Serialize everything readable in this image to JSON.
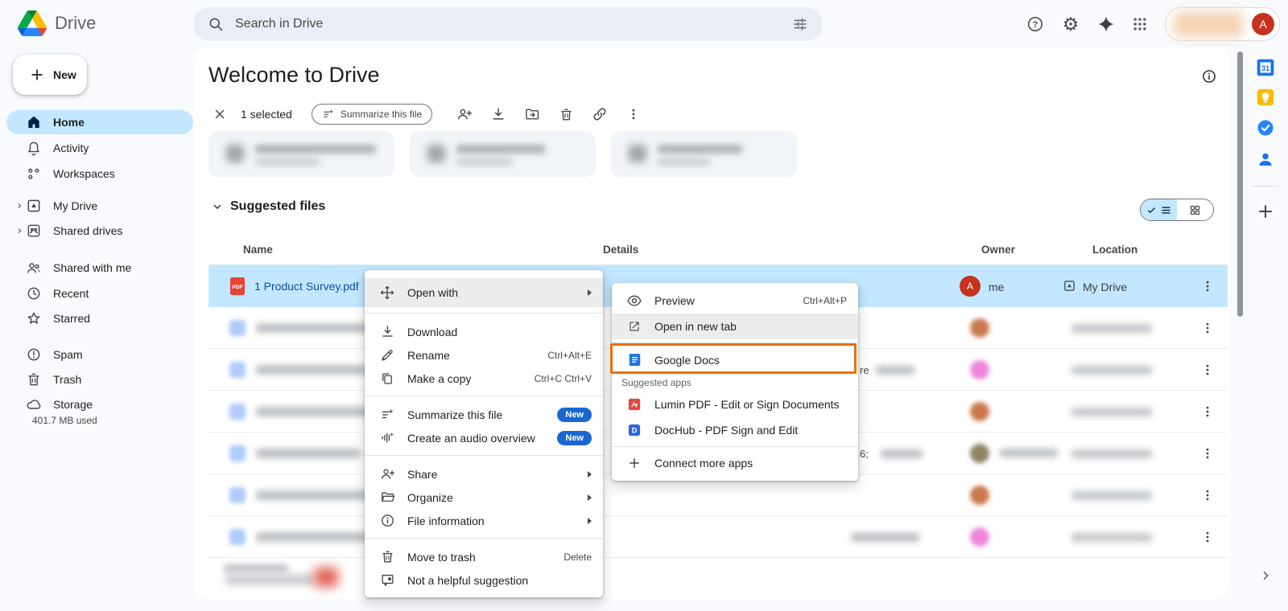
{
  "colors": {
    "background": "#f8fafd",
    "search_bg": "#e9eef6",
    "selection_blue": "#c2e7ff",
    "accent_blue": "#0b57d0",
    "link_blue_filename": "#0d4da8",
    "new_badge_blue": "#1967d2",
    "highlight_orange": "#e8710a",
    "pdf_red": "#ea4335",
    "avatar_red": "#c5321f"
  },
  "topbar": {
    "app_name": "Drive",
    "search_placeholder": "Search in Drive",
    "avatar_initial": "A"
  },
  "sidebar": {
    "new_label": "New",
    "items": [
      "Home",
      "Activity",
      "Workspaces",
      "My Drive",
      "Shared drives",
      "Shared with me",
      "Recent",
      "Starred",
      "Spam",
      "Trash",
      "Storage"
    ],
    "storage_used": "401.7 MB used"
  },
  "main": {
    "title": "Welcome to Drive",
    "toolbar": {
      "selected_count": "1 selected",
      "summarize": "Summarize this file"
    },
    "section_title": "Suggested files",
    "table_headers": {
      "name": "Name",
      "details": "Details",
      "owner": "Owner",
      "location": "Location"
    },
    "selected_row": {
      "name": "1 Product Survey.pdf",
      "owner": "me",
      "owner_initial": "A",
      "location": "My Drive"
    },
    "detail_fragments": {
      "row3": "re",
      "row5": "6;"
    }
  },
  "context_menu": {
    "open_with": "Open with",
    "download": "Download",
    "rename": "Rename",
    "rename_shortcut": "Ctrl+Alt+E",
    "make_a_copy": "Make a copy",
    "copy_shortcut": "Ctrl+C Ctrl+V",
    "summarize": "Summarize this file",
    "audio_overview": "Create an audio overview",
    "new_badge": "New",
    "share": "Share",
    "organize": "Organize",
    "file_information": "File information",
    "move_to_trash": "Move to trash",
    "trash_shortcut": "Delete",
    "not_helpful": "Not a helpful suggestion"
  },
  "submenu": {
    "preview": "Preview",
    "preview_shortcut": "Ctrl+Alt+P",
    "open_new_tab": "Open in new tab",
    "google_docs": "Google Docs",
    "suggested_apps": "Suggested apps",
    "lumin": "Lumin PDF - Edit or Sign Documents",
    "dochub": "DocHub - PDF Sign and Edit",
    "connect_more": "Connect more apps"
  }
}
